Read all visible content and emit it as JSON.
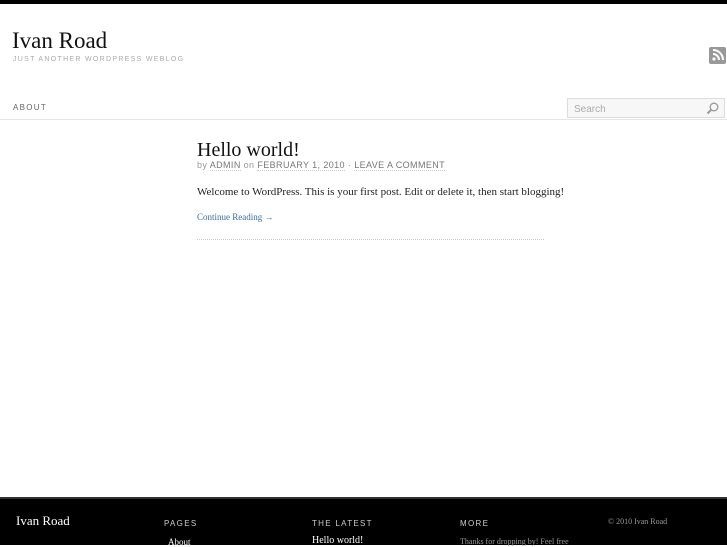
{
  "header": {
    "title": "Ivan Road",
    "tagline": "JUST ANOTHER WORDPRESS WEBLOG",
    "rss_icon": "rss-icon"
  },
  "nav": {
    "items": [
      {
        "label": "ABOUT"
      }
    ]
  },
  "search": {
    "placeholder": "Search"
  },
  "post": {
    "title": "Hello world!",
    "by": "by",
    "author": "ADMIN",
    "on": "on",
    "date": "FEBRUARY 1, 2010",
    "sep": "·",
    "comments": "LEAVE A COMMENT",
    "body": "Welcome to WordPress. This is your first post. Edit or delete it, then start blogging!",
    "continue": "Continue Reading →"
  },
  "footer": {
    "title": "Ivan Road",
    "pages_heading": "PAGES",
    "pages": [
      "About"
    ],
    "latest_heading": "THE LATEST",
    "latest": [
      "Hello world!"
    ],
    "more_heading": "MORE",
    "more_text": "Thanks for dropping by! Feel free",
    "copyright": "© 2010 Ivan Road"
  }
}
